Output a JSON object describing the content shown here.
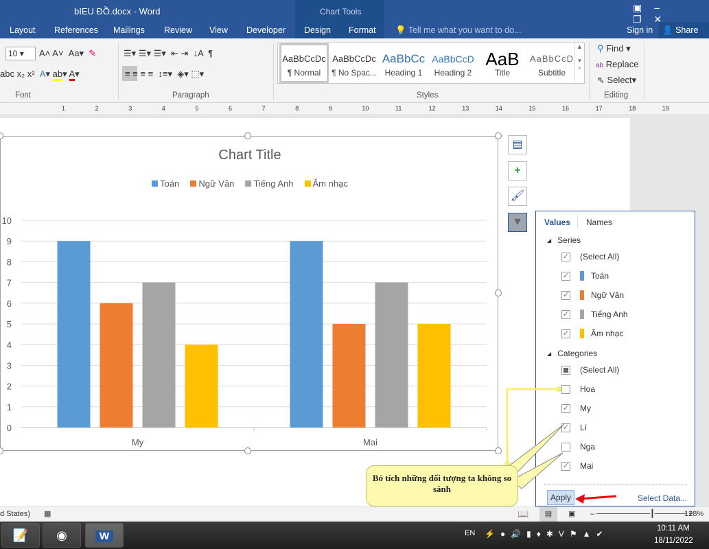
{
  "window": {
    "title": "bIEU ĐỒ.docx - Word",
    "context_group": "Chart Tools",
    "sign_in": "Sign in",
    "share": "Share"
  },
  "tabs": [
    "Layout",
    "References",
    "Mailings",
    "Review",
    "View",
    "Developer",
    "Design",
    "Format"
  ],
  "tell_me": "Tell me what you want to do...",
  "ribbon": {
    "font_size": "10",
    "groups": {
      "font": "Font",
      "paragraph": "Paragraph",
      "styles": "Styles",
      "editing": "Editing"
    },
    "styles": [
      {
        "preview": "AaBbCcDc",
        "name": "¶ Normal"
      },
      {
        "preview": "AaBbCcDc",
        "name": "¶ No Spac..."
      },
      {
        "preview": "AaBbCc",
        "name": "Heading 1"
      },
      {
        "preview": "AaBbCcD",
        "name": "Heading 2"
      },
      {
        "preview": "AaB",
        "name": "Title"
      },
      {
        "preview": "AaBbCcD",
        "name": "Subtitle"
      }
    ],
    "editing": {
      "find": "Find",
      "replace": "Replace",
      "select": "Select"
    }
  },
  "ruler": [
    "1",
    "2",
    "3",
    "4",
    "5",
    "6",
    "7",
    "8",
    "9",
    "10",
    "11",
    "12",
    "13",
    "14",
    "15",
    "16",
    "17",
    "18",
    "19"
  ],
  "chart_data": {
    "type": "bar",
    "title": "Chart Title",
    "legend": "top",
    "categories": [
      "My",
      "Mai"
    ],
    "series": [
      {
        "name": "Toán",
        "color": "#5b9bd5",
        "values": [
          9,
          9
        ]
      },
      {
        "name": "Ngữ Văn",
        "color": "#ed7d31",
        "values": [
          6,
          5
        ]
      },
      {
        "name": "Tiếng Anh",
        "color": "#a5a5a5",
        "values": [
          7,
          7
        ]
      },
      {
        "name": "Âm nhạc",
        "color": "#ffc000",
        "values": [
          4,
          5
        ]
      }
    ],
    "ylim": [
      0,
      10
    ],
    "yticks": [
      "0",
      "1",
      "2",
      "3",
      "4",
      "5",
      "6",
      "7",
      "8",
      "9",
      "10"
    ],
    "grid": true
  },
  "filter_panel": {
    "tabs": [
      "Values",
      "Names"
    ],
    "series_header": "Series",
    "categories_header": "Categories",
    "series": [
      {
        "label": "(Select All)",
        "checked": true
      },
      {
        "label": "Toán",
        "checked": true,
        "color": "#5b9bd5"
      },
      {
        "label": "Ngữ Văn",
        "checked": true,
        "color": "#ed7d31"
      },
      {
        "label": "Tiếng Anh",
        "checked": true,
        "color": "#a5a5a5"
      },
      {
        "label": "Âm nhạc",
        "checked": true,
        "color": "#ffc000"
      }
    ],
    "categories": [
      {
        "label": "(Select All)",
        "checked": "partial"
      },
      {
        "label": "Hoa",
        "checked": false
      },
      {
        "label": "My",
        "checked": true
      },
      {
        "label": "Lí",
        "checked": true
      },
      {
        "label": "Nga",
        "checked": false
      },
      {
        "label": "Mai",
        "checked": true
      }
    ],
    "apply": "Apply",
    "select_data": "Select Data..."
  },
  "callout": "Bỏ tích những đối tượng ta không so sánh",
  "status": {
    "language": "d States)",
    "zoom": "128%"
  },
  "taskbar": {
    "lang": "EN",
    "time": "10:11 AM",
    "date": "18/11/2022"
  }
}
